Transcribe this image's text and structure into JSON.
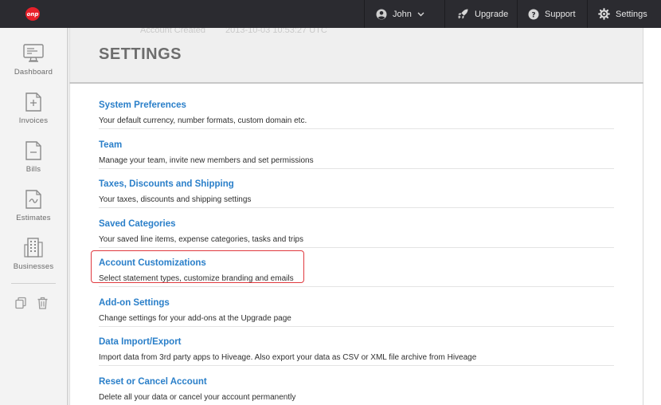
{
  "topbar": {
    "logo_text": "onp",
    "user_name": "John",
    "upgrade_label": "Upgrade",
    "support_label": "Support",
    "settings_label": "Settings"
  },
  "sidebar": {
    "items": [
      {
        "label": "Dashboard",
        "icon": "dashboard-icon"
      },
      {
        "label": "Invoices",
        "icon": "invoice-plus-icon"
      },
      {
        "label": "Bills",
        "icon": "bill-minus-icon"
      },
      {
        "label": "Estimates",
        "icon": "estimate-wave-icon"
      },
      {
        "label": "Businesses",
        "icon": "building-icon"
      }
    ],
    "tools": [
      "copy-icon",
      "trash-icon"
    ]
  },
  "header": {
    "ghost_label": "Account Created",
    "ghost_value": "2013-10-03 10:53:27 UTC",
    "title": "SETTINGS"
  },
  "settings": [
    {
      "title": "System Preferences",
      "desc": "Your default currency, number formats, custom domain etc."
    },
    {
      "title": "Team",
      "desc": "Manage your team, invite new members and set permissions"
    },
    {
      "title": "Taxes, Discounts and Shipping",
      "desc": "Your taxes, discounts and shipping settings"
    },
    {
      "title": "Saved Categories",
      "desc": "Your saved line items, expense categories, tasks and trips"
    },
    {
      "title": "Account Customizations",
      "desc": "Select statement types, customize branding and emails"
    },
    {
      "title": "Add-on Settings",
      "desc": "Change settings for your add-ons at the Upgrade page"
    },
    {
      "title": "Data Import/Export",
      "desc": "Import data from 3rd party apps to Hiveage. Also export your data as CSV or XML file archive from Hiveage"
    },
    {
      "title": "Reset or Cancel Account",
      "desc": "Delete all your data or cancel your account permanently"
    }
  ],
  "colors": {
    "topbar": "#2b2b30",
    "link": "#2a7fc9",
    "highlight": "#e0393f",
    "logo": "#e8202a"
  }
}
